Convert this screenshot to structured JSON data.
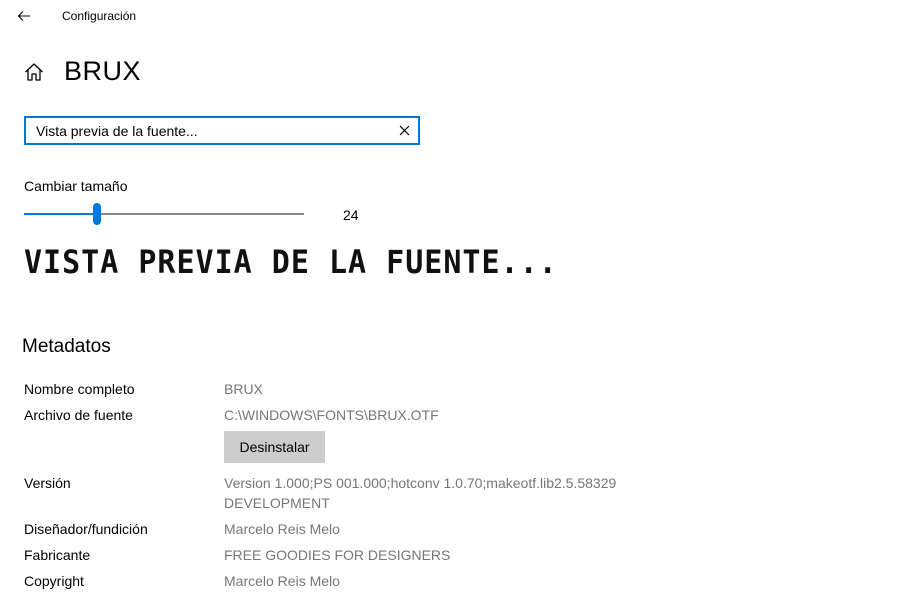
{
  "window": {
    "title": "Configuración"
  },
  "header": {
    "title": "BRUX"
  },
  "preview_input": {
    "value": "Vista previa de la fuente..."
  },
  "size": {
    "label": "Cambiar tamaño",
    "value": "24",
    "slider_fraction": 0.26
  },
  "preview": {
    "text": "VISTA PREVIA DE LA FUENTE..."
  },
  "metadata": {
    "title": "Metadatos",
    "full_name_label": "Nombre completo",
    "full_name_value": "BRUX",
    "file_label": "Archivo de fuente",
    "file_value": "C:\\WINDOWS\\FONTS\\BRUX.OTF",
    "uninstall_label": "Desinstalar",
    "version_label": "Versión",
    "version_value_line1": "Version 1.000;PS 001.000;hotconv 1.0.70;makeotf.lib2.5.58329",
    "version_value_line2": "DEVELOPMENT",
    "designer_label": "Diseñador/fundición",
    "designer_value": "Marcelo Reis Melo",
    "manufacturer_label": "Fabricante",
    "manufacturer_value": "FREE GOODIES FOR DESIGNERS",
    "copyright_label": "Copyright",
    "copyright_value": "Marcelo Reis Melo"
  },
  "colors": {
    "accent": "#0078d7",
    "value_text": "#767676",
    "button_bg": "#cccccc"
  },
  "icons": {
    "back": "back-arrow-icon",
    "home": "home-icon",
    "clear": "close-icon"
  }
}
